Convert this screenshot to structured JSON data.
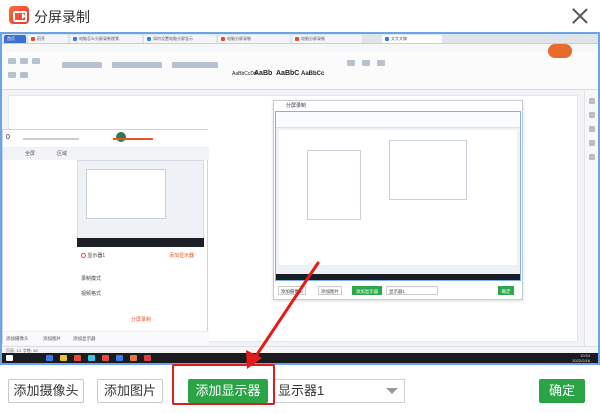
{
  "window": {
    "title": "分屏录制"
  },
  "embedded_screen": {
    "browser_tabs": [
      "首页",
      "稻壳",
      "电脑怎么分屏录制视频",
      "如何设置电脑分屏显示",
      "电脑分屏录制",
      "文字文稿"
    ],
    "ribbon_styles": [
      "AaBbCcDd",
      "AaBb",
      "AaBbC",
      "AaBbCc",
      "AaBbCcDd"
    ],
    "nested_left": {
      "header_left": "0",
      "labels": [
        "显示器1",
        "添加显示器"
      ],
      "rows": [
        "录制模式",
        "视频格式",
        "分屏录制"
      ],
      "tab_labels": [
        "全屏",
        "区域"
      ],
      "footer": [
        "添加摄像头",
        "添加图片",
        "添加显示器"
      ]
    },
    "nested_right": {
      "title": "分屏录制",
      "buttons": [
        "添加摄像头",
        "添加图片",
        "添加显示器",
        "显示器1",
        "确定"
      ]
    },
    "status_text": "页面: 1/1   字数: 48",
    "clock": {
      "time": "10:54",
      "date": "2022/2/16"
    }
  },
  "bottom_bar": {
    "add_camera_label": "添加摄像头",
    "add_image_label": "添加图片",
    "add_display_label": "添加显示器",
    "display_select_value": "显示器1",
    "confirm_label": "确定"
  },
  "colors": {
    "accent_green": "#2aa446",
    "annotation_red": "#e21b1b",
    "preview_border": "#6aa5e8"
  }
}
